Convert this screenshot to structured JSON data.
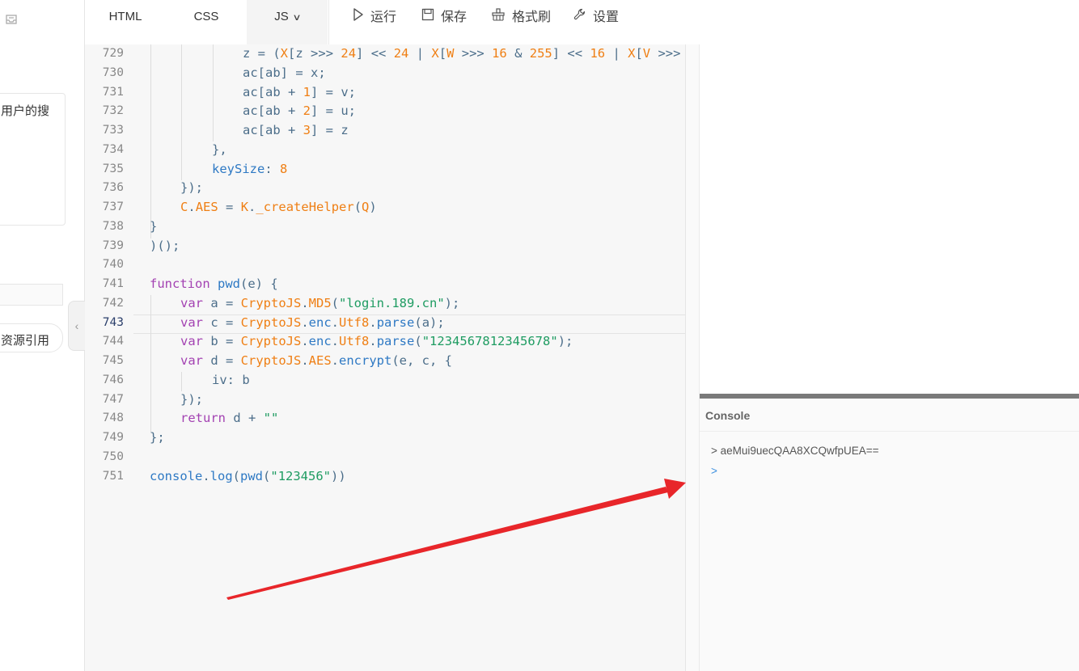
{
  "sidebar": {
    "card_text": "用户的搜",
    "chip_text": "资源引用",
    "collapse_glyph": "‹"
  },
  "toolbar": {
    "tabs": {
      "html": "HTML",
      "css": "CSS",
      "js": "JS"
    },
    "run": "运行",
    "save": "保存",
    "format": "格式刷",
    "settings": "设置"
  },
  "editor": {
    "line_numbers": [
      "729",
      "730",
      "731",
      "732",
      "733",
      "734",
      "735",
      "736",
      "737",
      "738",
      "739",
      "740",
      "741",
      "742",
      "743",
      "744",
      "745",
      "746",
      "747",
      "748",
      "749",
      "750",
      "751"
    ],
    "active_line": "743",
    "code": {
      "l729": {
        "a": "z",
        "b": " = (",
        "c": "X",
        "d": "[",
        "e": "z",
        "f": " >>> ",
        "g": "24",
        "h": "] << ",
        "i": "24",
        "j": " | ",
        "k": "X",
        "l": "[",
        "m": "W",
        "n": " >>> ",
        "o": "16",
        "p": " & ",
        "q": "255",
        "r": "] << ",
        "s": "16",
        "t": " | ",
        "u": "X",
        "v": "[",
        "w": "V",
        "x": " >>>"
      },
      "l730": "ac[ab] = x;",
      "l731": {
        "a": "ac[ab + ",
        "b": "1",
        "c": "] = v;"
      },
      "l732": {
        "a": "ac[ab + ",
        "b": "2",
        "c": "] = u;"
      },
      "l733": {
        "a": "ac[ab + ",
        "b": "3",
        "c": "] = z"
      },
      "l734": "},",
      "l735": {
        "a": "keySize",
        "b": ": ",
        "c": "8"
      },
      "l736": "});",
      "l737": {
        "a": "C",
        "b": ".",
        "c": "AES",
        "d": " = ",
        "e": "K",
        "f": ".",
        "g": "_createHelper",
        "h": "(",
        "i": "Q",
        "j": ")"
      },
      "l738": "}",
      "l739": ")();",
      "l741": {
        "a": "function",
        "b": " ",
        "c": "pwd",
        "d": "(e) {"
      },
      "l742": {
        "a": "var",
        "b": " a = ",
        "c": "CryptoJS",
        "d": ".",
        "e": "MD5",
        "f": "(",
        "g": "\"login.189.cn\"",
        "h": ");"
      },
      "l743": {
        "a": "var",
        "b": " c = ",
        "c": "CryptoJS",
        "d": ".",
        "e": "enc",
        "f": ".",
        "g": "Utf8",
        "h": ".",
        "i": "parse",
        "j": "(a);"
      },
      "l744": {
        "a": "var",
        "b": " b = ",
        "c": "CryptoJS",
        "d": ".",
        "e": "enc",
        "f": ".",
        "g": "Utf8",
        "h": ".",
        "i": "parse",
        "j": "(",
        "k": "\"1234567812345678\"",
        "l": ");"
      },
      "l745": {
        "a": "var",
        "b": " d = ",
        "c": "CryptoJS",
        "d": ".",
        "e": "AES",
        "f": ".",
        "g": "encrypt",
        "h": "(e, c, {"
      },
      "l746": "iv: b",
      "l747": "});",
      "l748": {
        "a": "return",
        "b": " d + ",
        "c": "\"\""
      },
      "l749": "};",
      "l751": {
        "a": "console",
        "b": ".",
        "c": "log",
        "d": "(",
        "e": "pwd",
        "f": "(",
        "g": "\"123456\"",
        "h": "))"
      }
    }
  },
  "console": {
    "title": "Console",
    "output": "> aeMui9uecQAA8XCQwfpUEA==",
    "prompt": ">"
  },
  "colors": {
    "keyword": "#a342b2",
    "number": "#ef7f14",
    "string": "#1f9c62",
    "function": "#2e79c4",
    "plain": "#4c6e8a",
    "arrow": "#e8262a"
  },
  "icons": {
    "run": "play-icon",
    "save": "save-icon",
    "format": "format-brush-icon",
    "settings": "wrench-icon",
    "js_tab": "chevron-down-icon",
    "sidebar_top": "inbox-icon"
  }
}
